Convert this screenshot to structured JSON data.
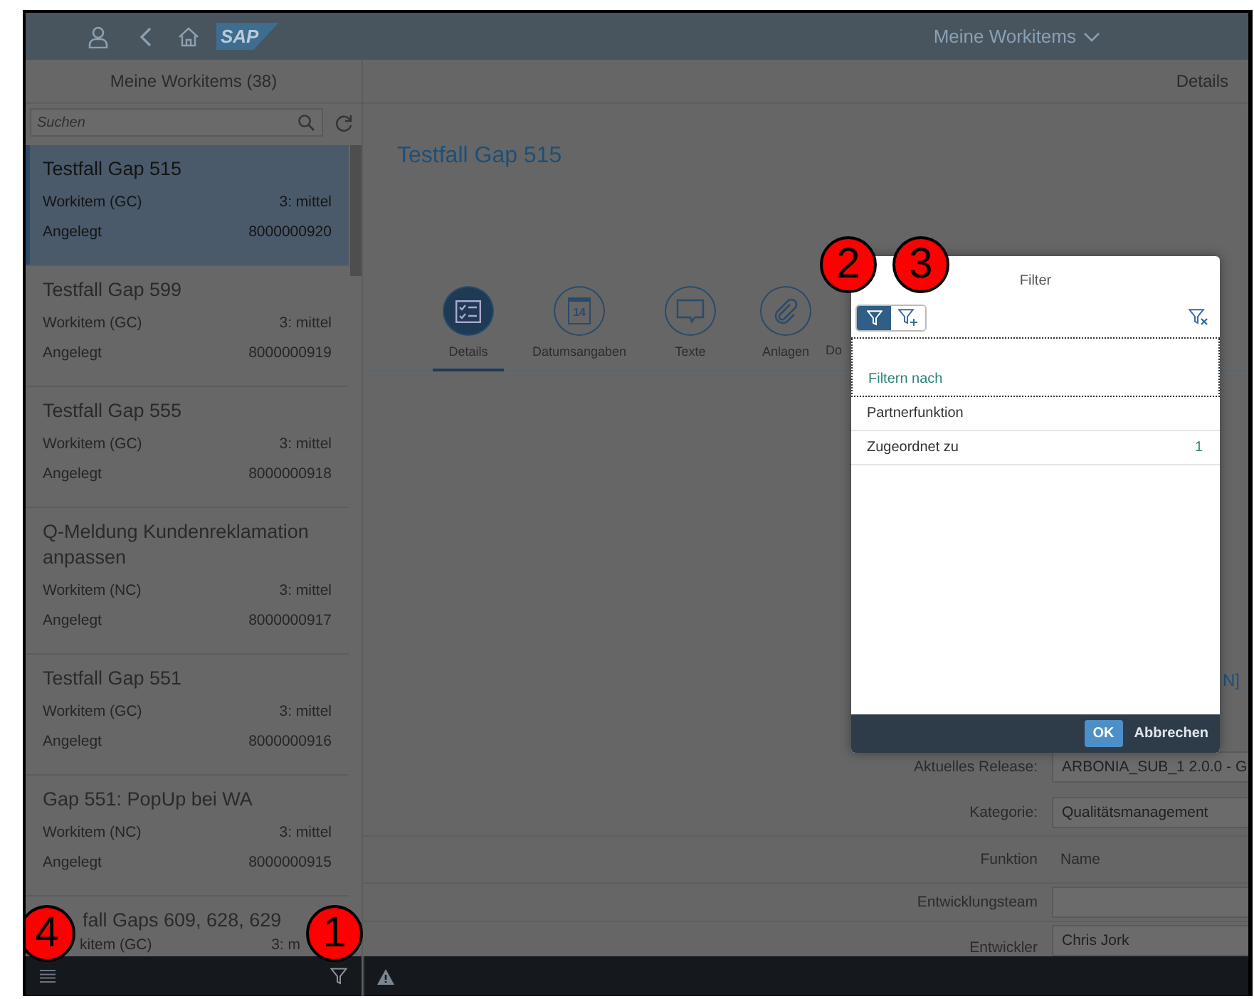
{
  "header": {
    "logo": "SAP",
    "title": "Meine Workitems"
  },
  "master": {
    "title": "Meine Workitems (38)",
    "search": {
      "placeholder": "Suchen"
    },
    "items": [
      {
        "title": "Testfall Gap 515",
        "type": "Workitem (GC)",
        "priority": "3: mittel",
        "status": "Angelegt",
        "number": "8000000920",
        "selected": true
      },
      {
        "title": "Testfall Gap 599",
        "type": "Workitem (GC)",
        "priority": "3: mittel",
        "status": "Angelegt",
        "number": "8000000919",
        "selected": false
      },
      {
        "title": "Testfall Gap 555",
        "type": "Workitem (GC)",
        "priority": "3: mittel",
        "status": "Angelegt",
        "number": "8000000918",
        "selected": false
      },
      {
        "title": "Q-Meldung Kundenreklamation anpassen",
        "type": "Workitem (NC)",
        "priority": "3: mittel",
        "status": "Angelegt",
        "number": "8000000917",
        "selected": false
      },
      {
        "title": "Testfall Gap 551",
        "type": "Workitem (GC)",
        "priority": "3: mittel",
        "status": "Angelegt",
        "number": "8000000916",
        "selected": false
      },
      {
        "title": "Gap 551: PopUp bei WA",
        "type": "Workitem (NC)",
        "priority": "3: mittel",
        "status": "Angelegt",
        "number": "8000000915",
        "selected": false
      }
    ],
    "partial_item": {
      "title": "fall Gaps 609, 628, 629",
      "type": "kitem (GC)",
      "priority": "3: m"
    }
  },
  "detail": {
    "header": "Details",
    "title": "Testfall Gap 515",
    "tabs": [
      {
        "label": "Details",
        "selected": true
      },
      {
        "label": "Datumsangaben",
        "badge": "14",
        "selected": false
      },
      {
        "label": "Texte",
        "selected": false
      },
      {
        "label": "Anlagen",
        "selected": false
      },
      {
        "label": "Do",
        "selected": false
      }
    ],
    "link_fragment": "N]",
    "fields": [
      {
        "label": "Aktuelles Release:",
        "value": "ARBONIA_SUB_1 2.0.0 - G"
      },
      {
        "label": "Kategorie:",
        "value": "Qualitätsmanagement"
      }
    ],
    "table": {
      "columns": [
        "Funktion",
        "Name"
      ],
      "rows": [
        {
          "label": "Entwicklungsteam"
        },
        {
          "label": "Entwickler",
          "value": "Chris Jork"
        }
      ]
    }
  },
  "dialog": {
    "title": "Filter",
    "modes": [
      {
        "kind": "filter",
        "selected": true
      },
      {
        "kind": "filter-add",
        "selected": false
      }
    ],
    "group_header": "Filtern nach",
    "items": [
      {
        "label": "Partnerfunktion"
      },
      {
        "label": "Zugeordnet zu",
        "count": "1"
      }
    ],
    "buttons": [
      "OK",
      "Abbrechen"
    ]
  },
  "callouts": [
    "1",
    "2",
    "3",
    "4"
  ]
}
